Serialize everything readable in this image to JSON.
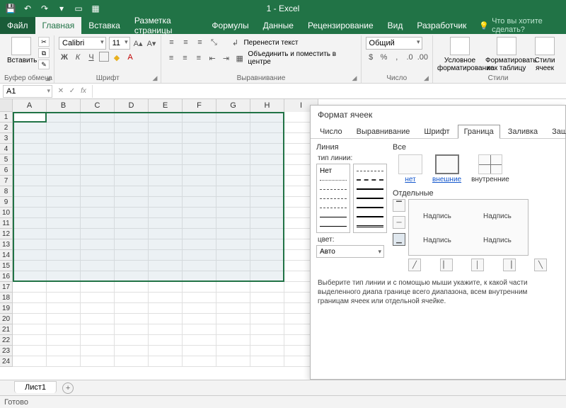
{
  "title": "1 - Excel",
  "qat": {
    "save": "💾",
    "undo": "↶",
    "redo": "↷",
    "touch": "⇅",
    "morebtn": "▾"
  },
  "menu": {
    "file": "Файл",
    "items": [
      "Главная",
      "Вставка",
      "Разметка страницы",
      "Формулы",
      "Данные",
      "Рецензирование",
      "Вид",
      "Разработчик"
    ],
    "active": 0,
    "tellme_icon": "💡",
    "tellme": "Что вы хотите сделать?"
  },
  "ribbon": {
    "clipboard": {
      "paste": "Вставить",
      "group": "Буфер обмена"
    },
    "font": {
      "name": "Calibri",
      "size": "11",
      "group": "Шрифт",
      "bold": "Ж",
      "italic": "К",
      "underline": "Ч"
    },
    "align": {
      "wrap": "Перенести текст",
      "merge": "Объединить и поместить в центре",
      "group": "Выравнивание"
    },
    "number": {
      "format": "Общий",
      "group": "Число"
    },
    "styles": {
      "cond": "Условное форматирование",
      "table": "Форматировать как таблицу",
      "cell": "Стили ячеек",
      "group": "Стили"
    }
  },
  "namebox": "A1",
  "formula": "",
  "grid": {
    "cols": [
      "A",
      "B",
      "C",
      "D",
      "E",
      "F",
      "G",
      "H",
      "I"
    ],
    "rows": 24
  },
  "sheettab": "Лист1",
  "addsheet": "+",
  "status": "Готово",
  "dialog": {
    "title": "Формат ячеек",
    "tabs": [
      "Число",
      "Выравнивание",
      "Шрифт",
      "Граница",
      "Заливка",
      "Защита"
    ],
    "active": 3,
    "line_section": "Линия",
    "line_type": "тип линии:",
    "line_none": "Нет",
    "color_label": "цвет:",
    "color_value": "Авто",
    "all_section": "Все",
    "presets": {
      "none": "нет",
      "outer": "внешние",
      "inner": "внутренние"
    },
    "sep_section": "Отдельные",
    "preview_label": "Надпись",
    "hint": "Выберите тип линии и с помощью мыши укажите, к какой части выделенного диапа границе всего диапазона, всем внутренним границам ячеек или отдельной ячейке."
  }
}
